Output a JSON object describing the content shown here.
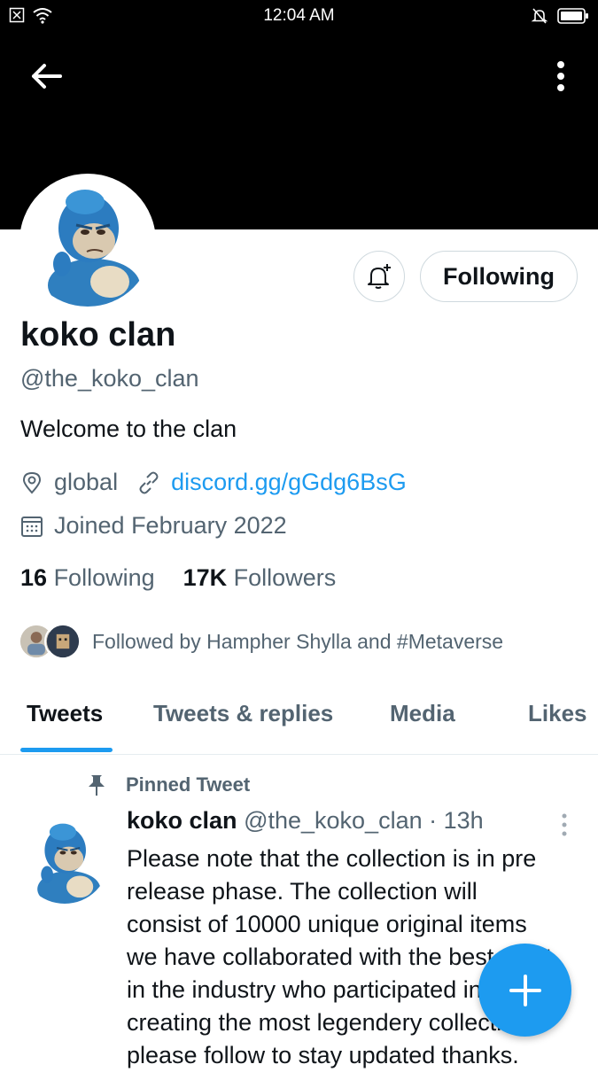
{
  "status_bar": {
    "time": "12:04 AM"
  },
  "profile": {
    "name": "koko clan",
    "handle": "@the_koko_clan",
    "bio": "Welcome to the clan",
    "location": "global",
    "website": "discord.gg/gGdg6BsG",
    "joined": "Joined February 2022",
    "following_count": "16",
    "following_label": "Following",
    "followers_count": "17K",
    "followers_label": "Followers",
    "followed_by": "Followed by Hampher Shylla and #Metaverse"
  },
  "actions": {
    "following_button": "Following"
  },
  "tabs": [
    {
      "label": "Tweets",
      "active": true
    },
    {
      "label": "Tweets & replies",
      "active": false
    },
    {
      "label": "Media",
      "active": false
    },
    {
      "label": "Likes",
      "active": false
    }
  ],
  "pinned_tweet": {
    "pinned_label": "Pinned Tweet",
    "author_name": "koko clan",
    "author_handle": "@the_koko_clan",
    "separator": "·",
    "time": "13h",
    "text_lines": [
      "Please note that the collection is in pre",
      "release phase. The collection will",
      "consist of 10000 unique original items",
      "we have collaborated with the best artist",
      "in the industry who participated in",
      "creating the most legendery collections",
      "please follow to stay updated thanks."
    ]
  },
  "colors": {
    "accent": "#1d9bf0",
    "text_primary": "#0f1419",
    "text_secondary": "#536471",
    "banner": "#000000"
  },
  "icons": [
    "back-arrow-icon",
    "more-vertical-icon",
    "bell-plus-icon",
    "location-pin-icon",
    "link-icon",
    "calendar-icon",
    "pin-icon",
    "compose-plus-icon",
    "wifi-icon",
    "battery-icon"
  ]
}
